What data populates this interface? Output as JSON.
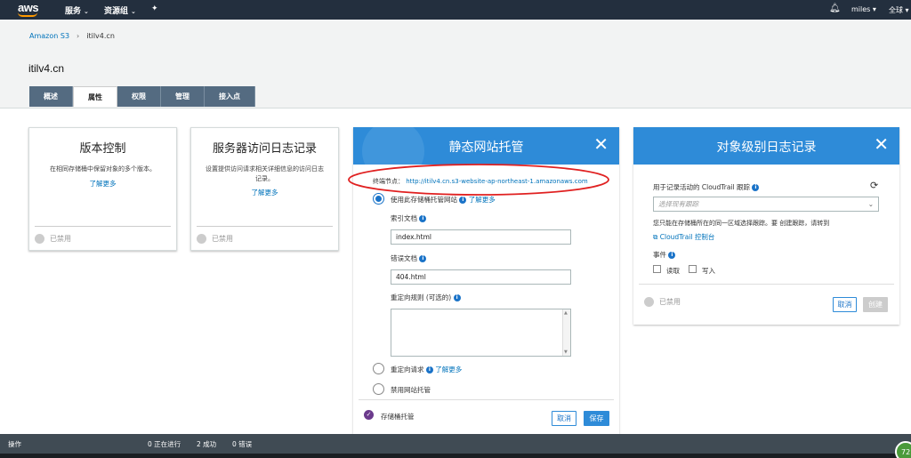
{
  "nav": {
    "logo": "aws",
    "services": "服务",
    "resource_groups": "资源组",
    "user": "miles",
    "region": "全球"
  },
  "breadcrumb": {
    "root": "Amazon S3",
    "sep": "›",
    "current": "itilv4.cn"
  },
  "page_title": "itilv4.cn",
  "tabs": [
    "概述",
    "属性",
    "权限",
    "管理",
    "接入点"
  ],
  "versioning": {
    "title": "版本控制",
    "desc": "在相同存储桶中保留对象的多个版本。",
    "more": "了解更多",
    "status": "已禁用"
  },
  "access_log": {
    "title": "服务器访问日志记录",
    "desc": "设置提供访问请求相关详细信息的访问日志记录。",
    "more": "了解更多",
    "status": "已禁用"
  },
  "website": {
    "title": "静态网站托管",
    "endpoint_label": "终端节点：",
    "endpoint_url": "http://itilv4.cn.s3-website-ap-northeast-1.amazonaws.com",
    "opt_host": "使用此存储桶托管网站",
    "opt_host_more": "了解更多",
    "index_label": "索引文档",
    "index_value": "index.html",
    "error_label": "错误文档",
    "error_value": "404.html",
    "redirect_rules_label": "重定向规则 (可选的)",
    "opt_redirect": "重定向请求",
    "opt_redirect_more": "了解更多",
    "opt_disable": "禁用网站托管",
    "footer_status": "存储桶托管",
    "cancel": "取消",
    "save": "保存"
  },
  "object_log": {
    "title": "对象级别日志记录",
    "trail_label": "用于记录活动的 CloudTrail 跟踪",
    "trail_placeholder": "选择现有跟踪",
    "note": "您只能在存储桶所在的同一区域选择跟踪。要 创建跟踪，请转到",
    "console_link": "CloudTrail 控制台",
    "events_label": "事件",
    "read": "读取",
    "write": "写入",
    "status": "已禁用",
    "cancel": "取消",
    "create": "创建"
  },
  "bottom": {
    "ops": "操作",
    "in_progress": "0 正在进行",
    "success": "2 成功",
    "errors": "0 错误",
    "badge": "72"
  },
  "colors": {
    "nav_bg": "#232f3e",
    "accent": "#2e8bd8",
    "link": "#0073bb",
    "annotation": "#e02020"
  }
}
